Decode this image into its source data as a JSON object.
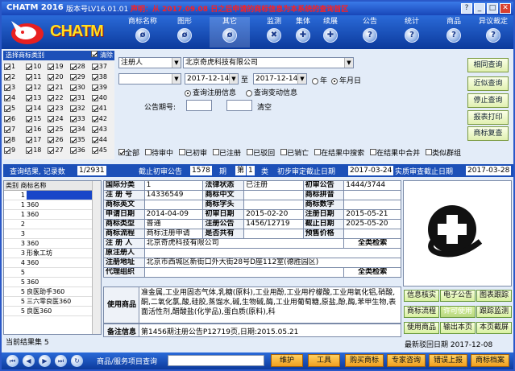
{
  "titlebar": {
    "app": "CHATM 2016",
    "version": "版本号LV16.01.01",
    "notice": "声明：从 2017.09.08 日之后申请的商标信息为本系统的查询首区"
  },
  "toolbar": {
    "logo": "CHATM",
    "tools": [
      {
        "label": "商标名称",
        "icon": "ø"
      },
      {
        "label": "图形",
        "icon": "ø"
      },
      {
        "label": "其它",
        "icon": "ø"
      },
      {
        "label": "监测",
        "icon": "✖"
      },
      {
        "label": "集体",
        "icon": "✚"
      },
      {
        "label": "续展",
        "icon": "✚"
      },
      {
        "label": "公告",
        "icon": "?"
      },
      {
        "label": "统计",
        "icon": "?"
      },
      {
        "label": "商品",
        "icon": "?"
      },
      {
        "label": "异议裁定",
        "icon": "?"
      }
    ]
  },
  "class_panel": {
    "title": "选择商标类别",
    "clear": "清除",
    "rows": [
      [
        "1",
        "10",
        "19",
        "28",
        "37"
      ],
      [
        "2",
        "11",
        "20",
        "29",
        "38"
      ],
      [
        "3",
        "12",
        "21",
        "30",
        "39"
      ],
      [
        "4",
        "13",
        "22",
        "31",
        "40"
      ],
      [
        "5",
        "14",
        "23",
        "32",
        "41"
      ],
      [
        "6",
        "15",
        "24",
        "33",
        "42"
      ],
      [
        "7",
        "16",
        "25",
        "34",
        "43"
      ],
      [
        "8",
        "17",
        "26",
        "35",
        "44"
      ],
      [
        "9",
        "18",
        "27",
        "36",
        "45"
      ]
    ]
  },
  "search": {
    "field": "注册人",
    "value": "北京奇虎科技有限公司",
    "date_from": "2017-12-14",
    "to": "至",
    "date_to": "2017-12-14",
    "year": "年",
    "ymd": "年月日",
    "opt1": "查询注册信息",
    "opt2": "查询变动信息",
    "period_label": "公告期号:",
    "clear": "清空"
  },
  "right_buttons": [
    "相同查询",
    "近似查询",
    "停止查询",
    "报表打印",
    "商标复查"
  ],
  "filters": [
    "全部",
    "待审中",
    "已初审",
    "已注册",
    "已驳回",
    "已销亡",
    "在结果中搜索",
    "在结果中合并",
    "类似群组"
  ],
  "infobar": {
    "label1": "查询结果, 记录数",
    "count": "1/2931",
    "label2": "截止初审公告",
    "v2": "1578",
    "u2": "期",
    "v3": "第",
    "v4": "1",
    "u3": "类",
    "label3": "初步审定截止日期",
    "d3": "2017-03-24",
    "label4": "实质审查截止日期",
    "d4": "2017-03-28"
  },
  "result_list": {
    "head": "类别 商标名称",
    "rows": [
      {
        "n": "1",
        "v": ""
      },
      {
        "n": "1",
        "v": "360"
      },
      {
        "n": "1",
        "v": "360"
      },
      {
        "n": "2",
        "v": ""
      },
      {
        "n": "3",
        "v": ""
      },
      {
        "n": "3",
        "v": "360"
      },
      {
        "n": "3",
        "v": "形象工坊"
      },
      {
        "n": "4",
        "v": "360"
      },
      {
        "n": "5",
        "v": ""
      },
      {
        "n": "5",
        "v": "360"
      },
      {
        "n": "5",
        "v": "良医助手360"
      },
      {
        "n": "5",
        "v": "三六零良医360"
      },
      {
        "n": "5",
        "v": "良医360"
      }
    ]
  },
  "detail": {
    "rows": [
      [
        "国际分类",
        "1",
        "法律状态",
        "已注册",
        "初审公告",
        "1444/3744"
      ],
      [
        "注 册 号",
        "14336549",
        "商标中文",
        "",
        "商标拼音",
        ""
      ],
      [
        "商标英文",
        "",
        "商标字头",
        "",
        "商标数字",
        ""
      ],
      [
        "申请日期",
        "2014-04-09",
        "初审日期",
        "2015-02-20",
        "注册日期",
        "2015-05-21"
      ],
      [
        "商标类型",
        "普通",
        "注册公告",
        "1456/12719",
        "截止日期",
        "2025-05-20"
      ],
      [
        "商标流程",
        "商标注册申请",
        "是否共有",
        "",
        "预售价格",
        ""
      ]
    ],
    "owner_k": "注 册 人",
    "owner_v": "北京奇虎科技有限公司",
    "owner_btn": "全类检索",
    "co_k": "原注册人",
    "addr_k": "注册地址",
    "addr_v": "北京市西城区新街口外大街28号D座112室(德胜园区)",
    "agent_k": "代理组织",
    "agent_btn": "全类检索"
  },
  "goods": {
    "k": "使用商品",
    "v": "准金属,工业用固态气体,乳糖(原料),工业用酚,工业用柠檬酸,工业用氧化铝,硝酸,酮,二氧化氯,酸,硅胶,蒸馏水,碱,生物碱,酶,工业用葡萄糖,原盐,酚,酶,苯甲生物,表面活性剂,醋酸盐(化学品),蛋白质(原料),科"
  },
  "remark": {
    "k": "备注信息",
    "v": "第1456期注册公告P12719页,日期:2015.05.21"
  },
  "green_buttons": [
    "信息核实",
    "电子公告",
    "图表跟踪",
    "商标流程",
    "许可使用",
    "跟踪监测",
    "使用商品",
    "输出本页",
    "本页截屏"
  ],
  "rejection": "最新驳回日期 2017-12-08",
  "status": "当前结果集 5",
  "bottom": {
    "label": "商品/服务项目查询",
    "buttons": [
      "维护",
      "工具",
      "购买商标",
      "专家咨询",
      "错误上报",
      "商标档案"
    ]
  }
}
